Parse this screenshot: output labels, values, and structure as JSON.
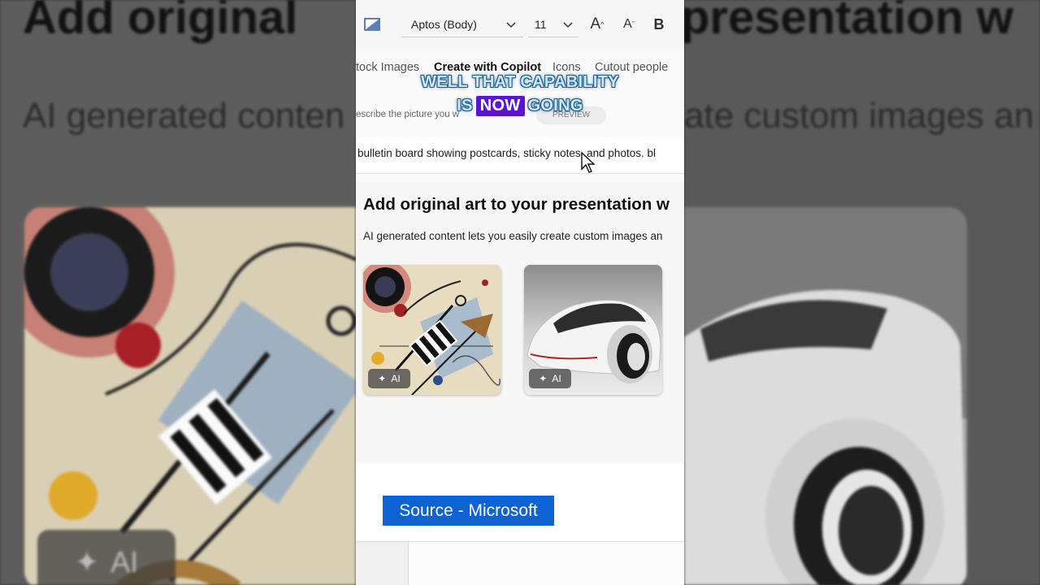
{
  "background": {
    "left_heading": "Add original",
    "left_sub": "AI generated conten",
    "right_heading": "presentation w",
    "right_sub": "ate custom images an",
    "ai_badge": "AI"
  },
  "toolbar": {
    "format_icon": "shape-fill-icon",
    "font_name": "Aptos (Body)",
    "font_size": "11",
    "grow_font": "A",
    "shrink_font": "A",
    "bold": "B"
  },
  "tabs": [
    {
      "label": "tock Images",
      "active": false
    },
    {
      "label": "Create with Copilot",
      "active": true
    },
    {
      "label": "Icons",
      "active": false
    },
    {
      "label": "Cutout people",
      "active": false
    }
  ],
  "caption": {
    "line1": "WELL THAT CAPABILITY",
    "line2_pre": "IS",
    "line2_highlight": "NOW",
    "line2_post": "GOING"
  },
  "describe_label": "escribe the picture you w",
  "preview_badge": "PREVIEW",
  "prompt_value": "bulletin board showing postcards, sticky notes, and photos. bl",
  "content": {
    "heading": "Add original art to your presentation w",
    "subtext": "AI generated content lets you easily create custom images an",
    "thumbnails": [
      {
        "subject": "abstract-kandinsky-art",
        "badge": "AI"
      },
      {
        "subject": "white-concept-car",
        "badge": "AI"
      }
    ]
  },
  "source_label": "Source - Microsoft",
  "colors": {
    "caption_highlight": "#5b14d6",
    "source_bg": "#0d63d3",
    "caption_text": "#cde7ff"
  }
}
